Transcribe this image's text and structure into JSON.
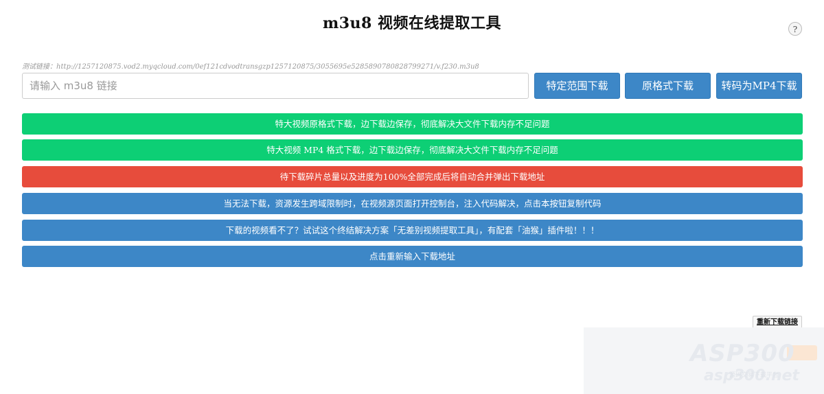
{
  "header": {
    "title": "m3u8 视频在线提取工具",
    "help_label": "?"
  },
  "test_link": "测试链接：http://1257120875.vod2.myqcloud.com/0ef121cdvodtransgzp1257120875/3055695e5285890780828799271/v.f230.m3u8",
  "input": {
    "placeholder": "请输入 m3u8 链接",
    "value": ""
  },
  "buttons": {
    "range_download": "特定范围下载",
    "original_download": "原格式下载",
    "mp4_download": "转码为MP4下载"
  },
  "bars": [
    {
      "label": "特大视频原格式下载，边下载边保存，彻底解决大文件下载内存不足问题",
      "color": "#0dcf75"
    },
    {
      "label": "特大视频 MP4 格式下载，边下载边保存，彻底解决大文件下载内存不足问题",
      "color": "#0dcf75"
    },
    {
      "label": "待下载碎片总量以及进度为100%全部完成后将自动合并弹出下载地址",
      "color": "#e74c3c"
    },
    {
      "label": "当无法下载，资源发生跨域限制时，在视频源页面打开控制台，注入代码解决，点击本按钮复制代码",
      "color": "#3d87c7"
    },
    {
      "label": "下载的视频看不了？试试这个终结解决方案「无差别视频提取工具」，有配套「油猴」插件啦！！！",
      "color": "#3d87c7"
    },
    {
      "label": "点击重新输入下载地址",
      "color": "#3d87c7"
    }
  ],
  "reset_link": "重新下载链接",
  "watermark": {
    "main": "ASP300",
    "sub": "asp300.net",
    "small": "源码交易下载平台"
  },
  "colors": {
    "primary_blue": "#3d87c7",
    "success_green": "#0dcf75",
    "danger_red": "#e74c3c"
  }
}
